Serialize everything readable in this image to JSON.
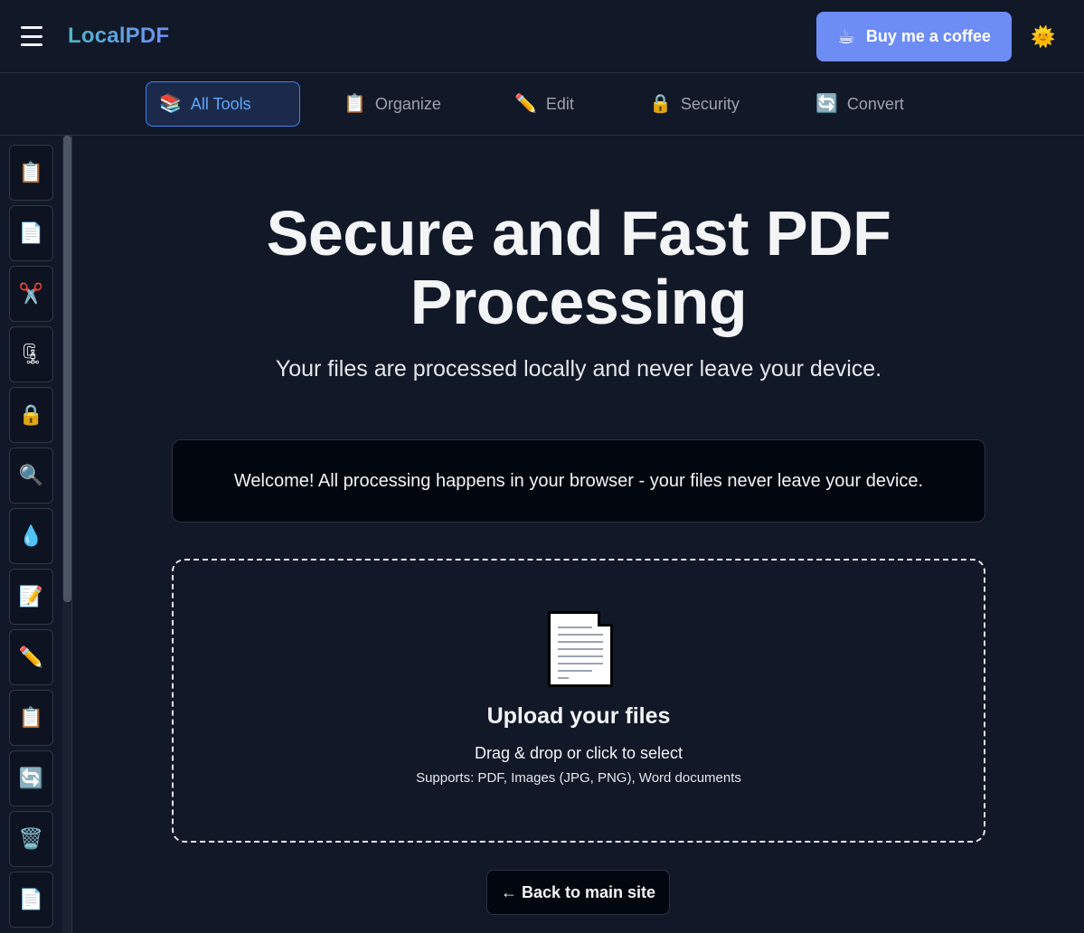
{
  "header": {
    "logo": "LocalPDF",
    "coffee_label": "Buy me a coffee",
    "coffee_icon": "☕",
    "theme_icon": "🌞"
  },
  "tabs": [
    {
      "label": "All Tools",
      "icon": "📚"
    },
    {
      "label": "Organize",
      "icon": "📋"
    },
    {
      "label": "Edit",
      "icon": "✏️"
    },
    {
      "label": "Security",
      "icon": "🔒"
    },
    {
      "label": "Convert",
      "icon": "🔄"
    }
  ],
  "sidebar": {
    "items": [
      {
        "icon": "📋"
      },
      {
        "icon": "📄"
      },
      {
        "icon": "✂️"
      },
      {
        "icon": "🗜"
      },
      {
        "icon": "🔒"
      },
      {
        "icon": "🔍"
      },
      {
        "icon": "💧"
      },
      {
        "icon": "📝"
      },
      {
        "icon": "✏️"
      },
      {
        "icon": "📋"
      },
      {
        "icon": "🔄"
      },
      {
        "icon": "🗑️"
      },
      {
        "icon": "📄"
      }
    ]
  },
  "hero": {
    "title_line1": "Secure and Fast PDF",
    "title_line2": "Processing",
    "subtitle": "Your files are processed locally and never leave your device."
  },
  "welcome": "Welcome! All processing happens in your browser - your files never leave your device.",
  "upload": {
    "title": "Upload your files",
    "hint": "Drag & drop or click to select",
    "supports": "Supports: PDF, Images (JPG, PNG), Word documents"
  },
  "back_label": "← Back to main site"
}
